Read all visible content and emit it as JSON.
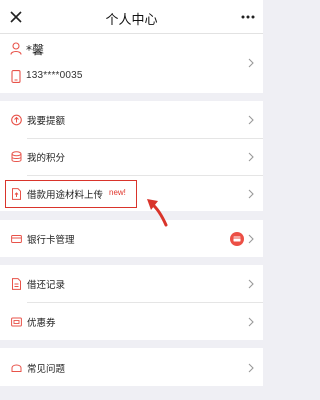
{
  "nav": {
    "title": "个人中心",
    "close_icon": "close-icon",
    "more_icon": "more-dots-icon"
  },
  "profile": {
    "name": "*馨",
    "phone": "133****0035",
    "user_icon": "user-icon",
    "phone_icon": "phone-icon"
  },
  "menu": {
    "withdraw": {
      "label": "我要提额",
      "icon": "limit-up-icon"
    },
    "points": {
      "label": "我的积分",
      "icon": "coins-icon"
    },
    "upload": {
      "label": "借款用途材料上传",
      "badge": "new!",
      "icon": "document-upload-icon"
    },
    "bank_card": {
      "label": "银行卡管理",
      "icon": "bank-card-icon"
    },
    "records": {
      "label": "借还记录",
      "icon": "records-icon"
    },
    "coupons": {
      "label": "优惠券",
      "icon": "coupon-icon"
    },
    "faq": {
      "label": "常见问题",
      "icon": "question-icon"
    }
  },
  "colors": {
    "accent": "#e0352b",
    "icon": "#e8534a",
    "background": "#efeff4"
  }
}
